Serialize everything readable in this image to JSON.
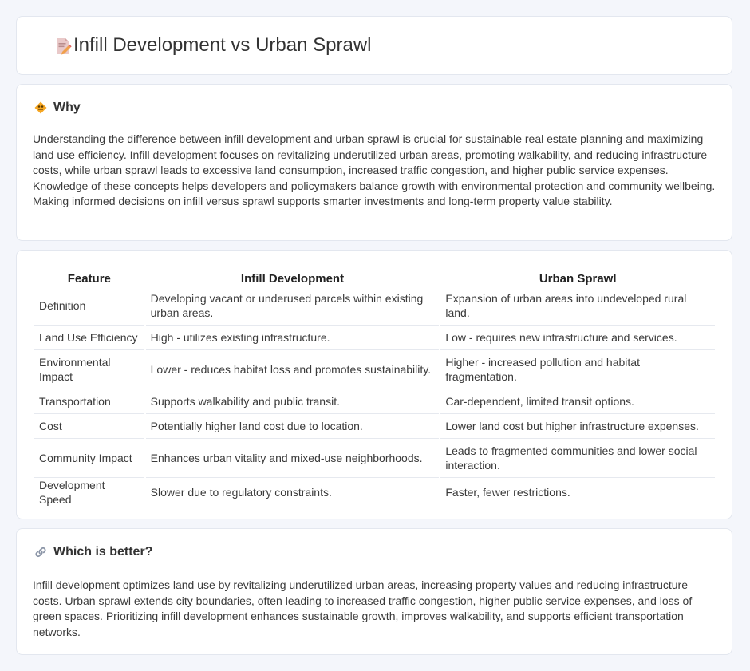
{
  "header": {
    "title": "Infill Development vs Urban Sprawl",
    "icon": "document-pencil-icon"
  },
  "why": {
    "title": "Why",
    "icon": "diamond-sign-icon",
    "text": "Understanding the difference between infill development and urban sprawl is crucial for sustainable real estate planning and maximizing land use efficiency. Infill development focuses on revitalizing underutilized urban areas, promoting walkability, and reducing infrastructure costs, while urban sprawl leads to excessive land consumption, increased traffic congestion, and higher public service expenses. Knowledge of these concepts helps developers and policymakers balance growth with environmental protection and community wellbeing. Making informed decisions on infill versus sprawl supports smarter investments and long-term property value stability."
  },
  "comparison": {
    "headers": [
      "Feature",
      "Infill Development",
      "Urban Sprawl"
    ],
    "rows": [
      [
        "Definition",
        "Developing vacant or underused parcels within existing urban areas.",
        "Expansion of urban areas into undeveloped rural land."
      ],
      [
        "Land Use Efficiency",
        "High - utilizes existing infrastructure.",
        "Low - requires new infrastructure and services."
      ],
      [
        "Environmental Impact",
        "Lower - reduces habitat loss and promotes sustainability.",
        "Higher - increased pollution and habitat fragmentation."
      ],
      [
        "Transportation",
        "Supports walkability and public transit.",
        "Car-dependent, limited transit options."
      ],
      [
        "Cost",
        "Potentially higher land cost due to location.",
        "Lower land cost but higher infrastructure expenses."
      ],
      [
        "Community Impact",
        "Enhances urban vitality and mixed-use neighborhoods.",
        "Leads to fragmented communities and lower social interaction."
      ],
      [
        "Development Speed",
        "Slower due to regulatory constraints.",
        "Faster, fewer restrictions."
      ]
    ]
  },
  "better": {
    "title": "Which is better?",
    "icon": "link-icon",
    "text": "Infill development optimizes land use by revitalizing underutilized urban areas, increasing property values and reducing infrastructure costs. Urban sprawl extends city boundaries, often leading to increased traffic congestion, higher public service expenses, and loss of green spaces. Prioritizing infill development enhances sustainable growth, improves walkability, and supports efficient transportation networks."
  }
}
